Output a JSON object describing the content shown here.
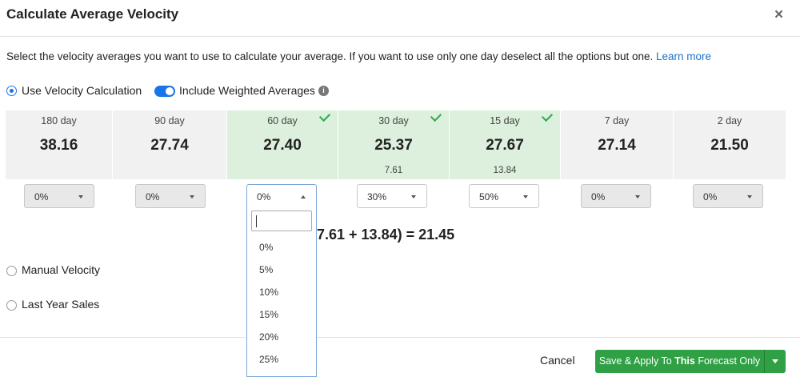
{
  "dialog": {
    "title": "Calculate Average Velocity",
    "close_symbol": "×",
    "description": "Select the velocity averages you want to use to calculate your average. If you want to use only one day deselect all the options but one.",
    "learn_more": "Learn more"
  },
  "options": {
    "use_velocity": "Use Velocity Calculation",
    "include_weighted": "Include Weighted Averages",
    "include_weighted_on": true,
    "info_symbol": "i",
    "manual_velocity": "Manual Velocity",
    "last_year_sales": "Last Year Sales",
    "selected_mode": "use_velocity"
  },
  "columns": [
    {
      "name": "180 day",
      "value": "38.16",
      "sub": "",
      "selected": false,
      "pct": "0%"
    },
    {
      "name": "90 day",
      "value": "27.74",
      "sub": "",
      "selected": false,
      "pct": "0%"
    },
    {
      "name": "60 day",
      "value": "27.40",
      "sub": "",
      "selected": true,
      "pct": "0%"
    },
    {
      "name": "30 day",
      "value": "25.37",
      "sub": "7.61",
      "selected": true,
      "pct": "30%"
    },
    {
      "name": "15 day",
      "value": "27.67",
      "sub": "13.84",
      "selected": true,
      "pct": "50%"
    },
    {
      "name": "7 day",
      "value": "27.14",
      "sub": "",
      "selected": false,
      "pct": "0%"
    },
    {
      "name": "2 day",
      "value": "21.50",
      "sub": "",
      "selected": false,
      "pct": "0%"
    }
  ],
  "formula": "7.61 + 13.84) = 21.45",
  "dropdown": {
    "search_value": "",
    "options": [
      "0%",
      "5%",
      "10%",
      "15%",
      "20%",
      "25%"
    ]
  },
  "footer": {
    "cancel": "Cancel",
    "save_prefix": "Save & Apply To ",
    "save_bold": "This",
    "save_suffix": " Forecast Only"
  },
  "colors": {
    "accent": "#1a73e8",
    "selected_column": "#dcf0dd",
    "check": "#2eaa4f",
    "save_button": "#2fa043"
  }
}
